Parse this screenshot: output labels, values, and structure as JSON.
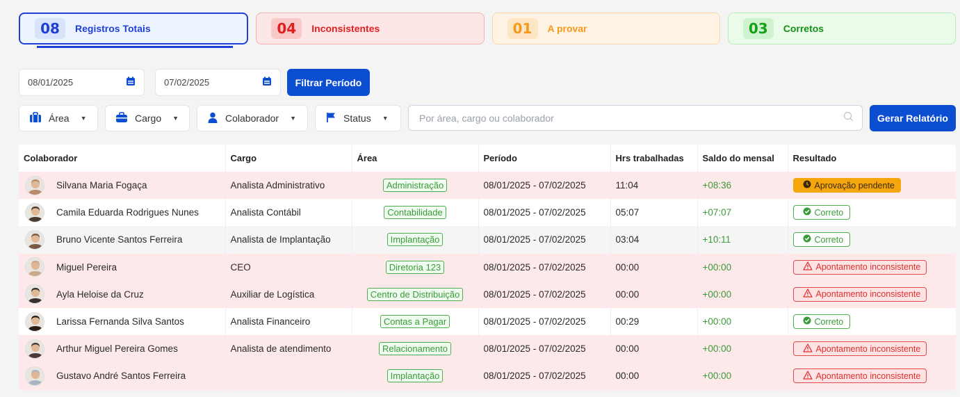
{
  "summary": {
    "total": {
      "count": "08",
      "label": "Registros Totais"
    },
    "inconsistent": {
      "count": "04",
      "label": "Inconsistentes"
    },
    "to_approve": {
      "count": "01",
      "label": "A provar"
    },
    "correct": {
      "count": "03",
      "label": "Corretos"
    }
  },
  "period": {
    "start": "08/01/2025",
    "end": "07/02/2025",
    "filter_button": "Filtrar Período"
  },
  "filters": {
    "area": "Área",
    "cargo": "Cargo",
    "colaborador": "Colaborador",
    "status": "Status"
  },
  "search": {
    "placeholder": "Por área, cargo ou colaborador"
  },
  "report_button": "Gerar Relatório",
  "table": {
    "headers": [
      "Colaborador",
      "Cargo",
      "Área",
      "Período",
      "Hrs trabalhadas",
      "Saldo do mensal",
      "Resultado"
    ],
    "rows": [
      {
        "name": "Silvana Maria Fogaça",
        "cargo": "Analista Administrativo",
        "area": "Administração",
        "periodo": "08/01/2025 - 07/02/2025",
        "hrs": "11:04",
        "saldo": "+08:36",
        "resultado": "Aprovação pendente",
        "status": "pend",
        "avatar_color": "#b98a6a"
      },
      {
        "name": "Camila Eduarda Rodrigues Nunes",
        "cargo": "Analista Contábil",
        "area": "Contabilidade",
        "periodo": "08/01/2025 - 07/02/2025",
        "hrs": "05:07",
        "saldo": "+07:07",
        "resultado": "Correto",
        "status": "ok",
        "avatar_color": "#4a3a30"
      },
      {
        "name": "Bruno Vicente Santos Ferreira",
        "cargo": "Analista de Implantação",
        "area": "Implantação",
        "periodo": "08/01/2025 - 07/02/2025",
        "hrs": "03:04",
        "saldo": "+10:11",
        "resultado": "Correto",
        "status": "ok",
        "avatar_color": "#7a5a44"
      },
      {
        "name": "Miguel Pereira",
        "cargo": "CEO",
        "area": "Diretoria 123",
        "periodo": "08/01/2025 - 07/02/2025",
        "hrs": "00:00",
        "saldo": "+00:00",
        "resultado": "Apontamento inconsistente",
        "status": "bad",
        "avatar_color": "#c9a98a"
      },
      {
        "name": "Ayla Heloise da Cruz",
        "cargo": "Auxiliar de Logística",
        "area": "Centro de Distribuição",
        "periodo": "08/01/2025 - 07/02/2025",
        "hrs": "00:00",
        "saldo": "+00:00",
        "resultado": "Apontamento inconsistente",
        "status": "bad",
        "avatar_color": "#3a3030"
      },
      {
        "name": "Larissa Fernanda Silva Santos",
        "cargo": "Analista Financeiro",
        "area": "Contas a Pagar",
        "periodo": "08/01/2025 - 07/02/2025",
        "hrs": "00:29",
        "saldo": "+00:00",
        "resultado": "Correto",
        "status": "ok",
        "avatar_color": "#2a1e18"
      },
      {
        "name": "Arthur Miguel Pereira Gomes",
        "cargo": "Analista de atendimento",
        "area": "Relacionamento",
        "periodo": "08/01/2025 - 07/02/2025",
        "hrs": "00:00",
        "saldo": "+00:00",
        "resultado": "Apontamento inconsistente",
        "status": "bad",
        "avatar_color": "#4a3a34"
      },
      {
        "name": "Gustavo André Santos Ferreira",
        "cargo": "",
        "area": "Implantação",
        "periodo": "08/01/2025 - 07/02/2025",
        "hrs": "00:00",
        "saldo": "+00:00",
        "resultado": "Apontamento inconsistente",
        "status": "bad",
        "avatar_color": "#a9b4c0"
      }
    ]
  },
  "colors": {
    "primary": "#0b4ed1",
    "inconsistent": "#e02020",
    "pending": "#f6a60d",
    "correct": "#16a016"
  }
}
